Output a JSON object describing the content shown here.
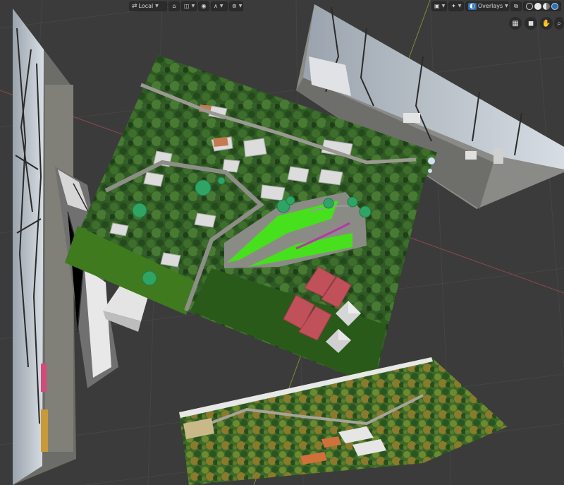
{
  "header": {
    "transform_space": "Local",
    "overlays_label": "Overlays"
  },
  "icons": {
    "transform": "axis-icon",
    "snap": "magnet-icon",
    "pivot": "pivot-icon",
    "proportional": "proportional-edit-icon",
    "falloff": "falloff-curve-icon",
    "visibility": "visibility-icon",
    "gizmo": "gizmo-icon",
    "overlays": "overlays-icon",
    "xray": "xray-icon",
    "shading": [
      "wireframe-shading-icon",
      "solid-shading-icon",
      "material-shading-icon",
      "rendered-shading-icon"
    ],
    "nav": [
      "grid-view-icon",
      "camera-icon",
      "hand-pan-icon",
      "zoom-icon"
    ]
  },
  "colors": {
    "viewport_bg": "#3b3b3b",
    "header_bg": "#2b2b2b",
    "active_blue": "#2f6fb6",
    "path_green": "#46e01c",
    "roof_red": "#c0505a"
  }
}
